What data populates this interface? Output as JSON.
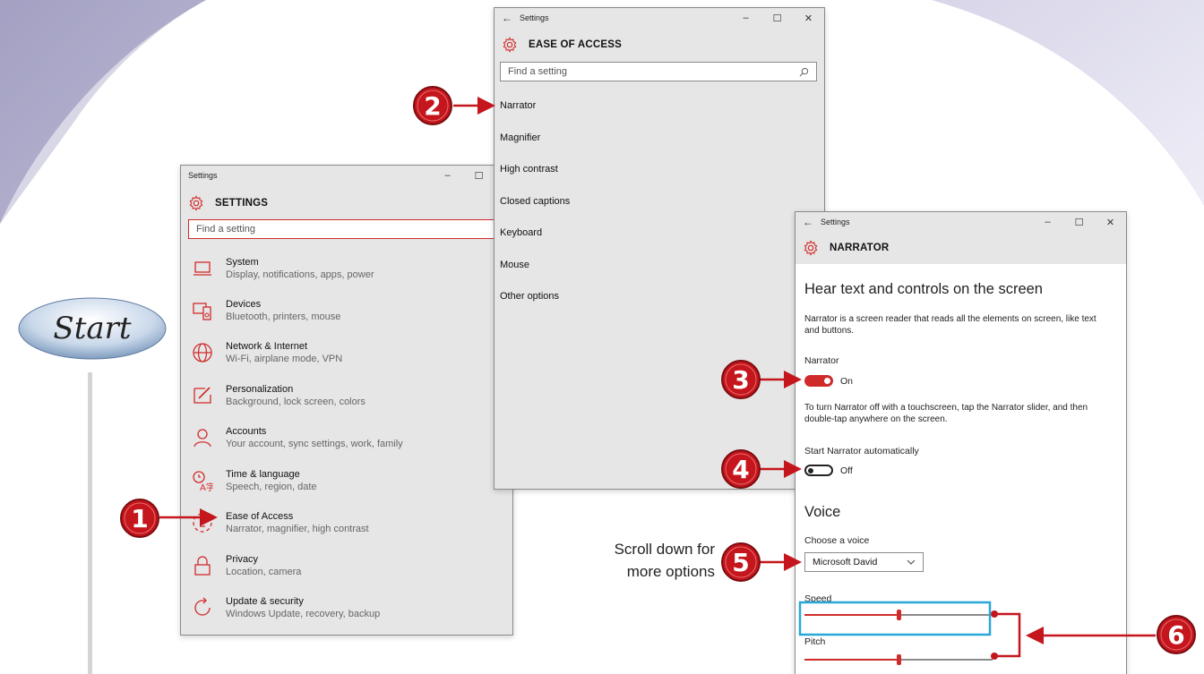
{
  "callout_text": {
    "line1": "Scroll down for",
    "line2": "more options"
  },
  "start_label": "Start",
  "callouts": [
    "1",
    "2",
    "3",
    "4",
    "5",
    "6"
  ],
  "settings_window": {
    "title": "Settings",
    "header": "SETTINGS",
    "search_placeholder": "Find a setting",
    "controls": {
      "minimize": "–",
      "maximize": "☐"
    },
    "categories": [
      {
        "title": "System",
        "subtitle": "Display, notifications, apps, power",
        "icon": "laptop-icon"
      },
      {
        "title": "Devices",
        "subtitle": "Bluetooth, printers, mouse",
        "icon": "devices-icon"
      },
      {
        "title": "Network & Internet",
        "subtitle": "Wi-Fi, airplane mode, VPN",
        "icon": "globe-icon"
      },
      {
        "title": "Personalization",
        "subtitle": "Background, lock screen, colors",
        "icon": "paintbrush-icon"
      },
      {
        "title": "Accounts",
        "subtitle": "Your account, sync settings, work, family",
        "icon": "person-icon"
      },
      {
        "title": "Time & language",
        "subtitle": "Speech, region, date",
        "icon": "time-language-icon"
      },
      {
        "title": "Ease of Access",
        "subtitle": "Narrator, magnifier, high contrast",
        "icon": "ease-of-access-icon"
      },
      {
        "title": "Privacy",
        "subtitle": "Location, camera",
        "icon": "lock-icon"
      },
      {
        "title": "Update & security",
        "subtitle": "Windows Update, recovery, backup",
        "icon": "update-icon"
      }
    ]
  },
  "ease_window": {
    "title": "Settings",
    "header": "EASE OF ACCESS",
    "search_placeholder": "Find a setting",
    "controls": {
      "back": "←",
      "minimize": "–",
      "maximize": "☐",
      "close": "✕"
    },
    "items": [
      "Narrator",
      "Magnifier",
      "High contrast",
      "Closed captions",
      "Keyboard",
      "Mouse",
      "Other options"
    ]
  },
  "narrator_window": {
    "title": "Settings",
    "header": "NARRATOR",
    "controls": {
      "back": "←",
      "minimize": "–",
      "maximize": "☐",
      "close": "✕"
    },
    "heading": "Hear text and controls on the screen",
    "description": "Narrator is a screen reader that reads all the elements on screen, like text and buttons.",
    "narrator_label": "Narrator",
    "narrator_state": "On",
    "touch_note": "To turn Narrator off with a touchscreen, tap the Narrator slider, and then double-tap anywhere on the screen.",
    "auto_label": "Start Narrator automatically",
    "auto_state": "Off",
    "voice_heading": "Voice",
    "choose_voice_label": "Choose a voice",
    "voice_value": "Microsoft David",
    "speed_label": "Speed",
    "speed_level": 0.5,
    "pitch_label": "Pitch",
    "pitch_level": 0.5
  },
  "colors": {
    "accent": "#d02b2b",
    "highlight": "#29a8d8",
    "callout_red": "#c4161c",
    "bg_arc": "#b8b6d2"
  }
}
